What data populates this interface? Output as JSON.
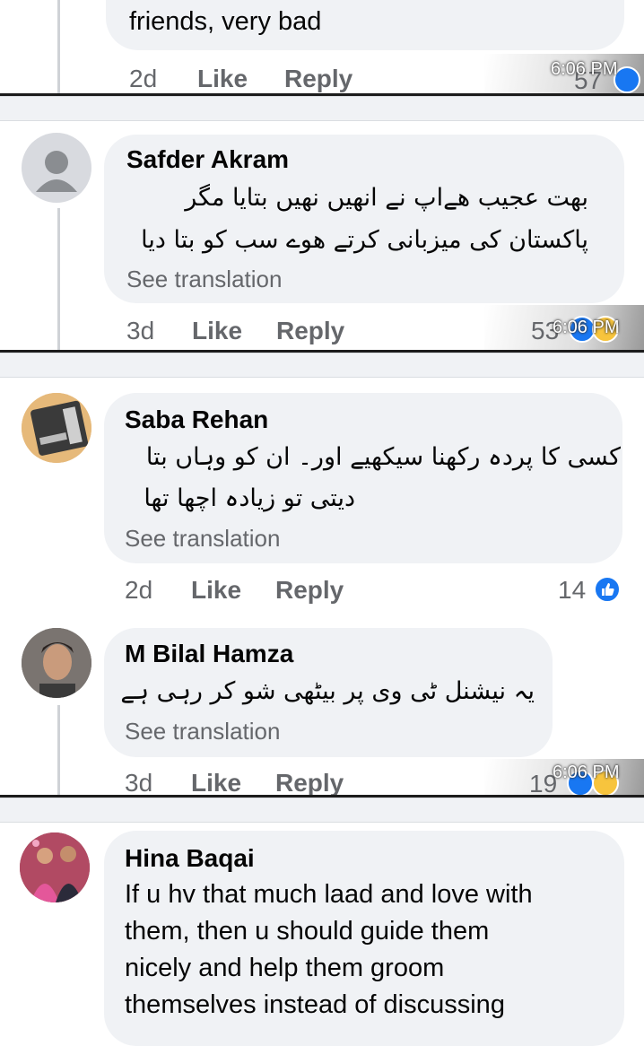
{
  "comments": [
    {
      "text_tail": "friends, very bad",
      "time": "2d",
      "like_label": "Like",
      "reply_label": "Reply",
      "count": "57",
      "stamp": "6:06 PM"
    },
    {
      "name": "Safder Akram",
      "text_lines": [
        "بهت عجیب هےاپ نے انهیں نهیں بتایا مگر",
        "پاکستان کی میزبانی کرتے هوے سب کو بتا دیا"
      ],
      "see_translation": "See translation",
      "time": "3d",
      "like_label": "Like",
      "reply_label": "Reply",
      "count": "53",
      "stamp": "6:06 PM"
    },
    {
      "name": "Saba Rehan",
      "text_lines": [
        "کسی کا پردہ رکھنا سیکھیے اور۔ ان کو وہاں بتا",
        "دیتی تو زیادہ اچھا تھا"
      ],
      "see_translation": "See translation",
      "time": "2d",
      "like_label": "Like",
      "reply_label": "Reply",
      "count": "14"
    },
    {
      "name": "M Bilal Hamza",
      "text_lines": [
        "یہ نیشنل ٹی وی پر بیٹھی شو کر رہی ہے"
      ],
      "see_translation": "See translation",
      "time": "3d",
      "like_label": "Like",
      "reply_label": "Reply",
      "count": "19",
      "stamp": "6:06 PM"
    },
    {
      "name": "Hina Baqai",
      "text_lines": [
        "If u hv that much laad and love with",
        "them, then u should guide them",
        "nicely and help them groom",
        "themselves instead of discussing"
      ]
    }
  ],
  "icons": {
    "like": "like-reaction-icon",
    "haha": "haha-reaction-icon"
  },
  "colors": {
    "bubble": "#f0f2f5",
    "like_blue": "#1877f2",
    "meta_gray": "#65676b"
  }
}
